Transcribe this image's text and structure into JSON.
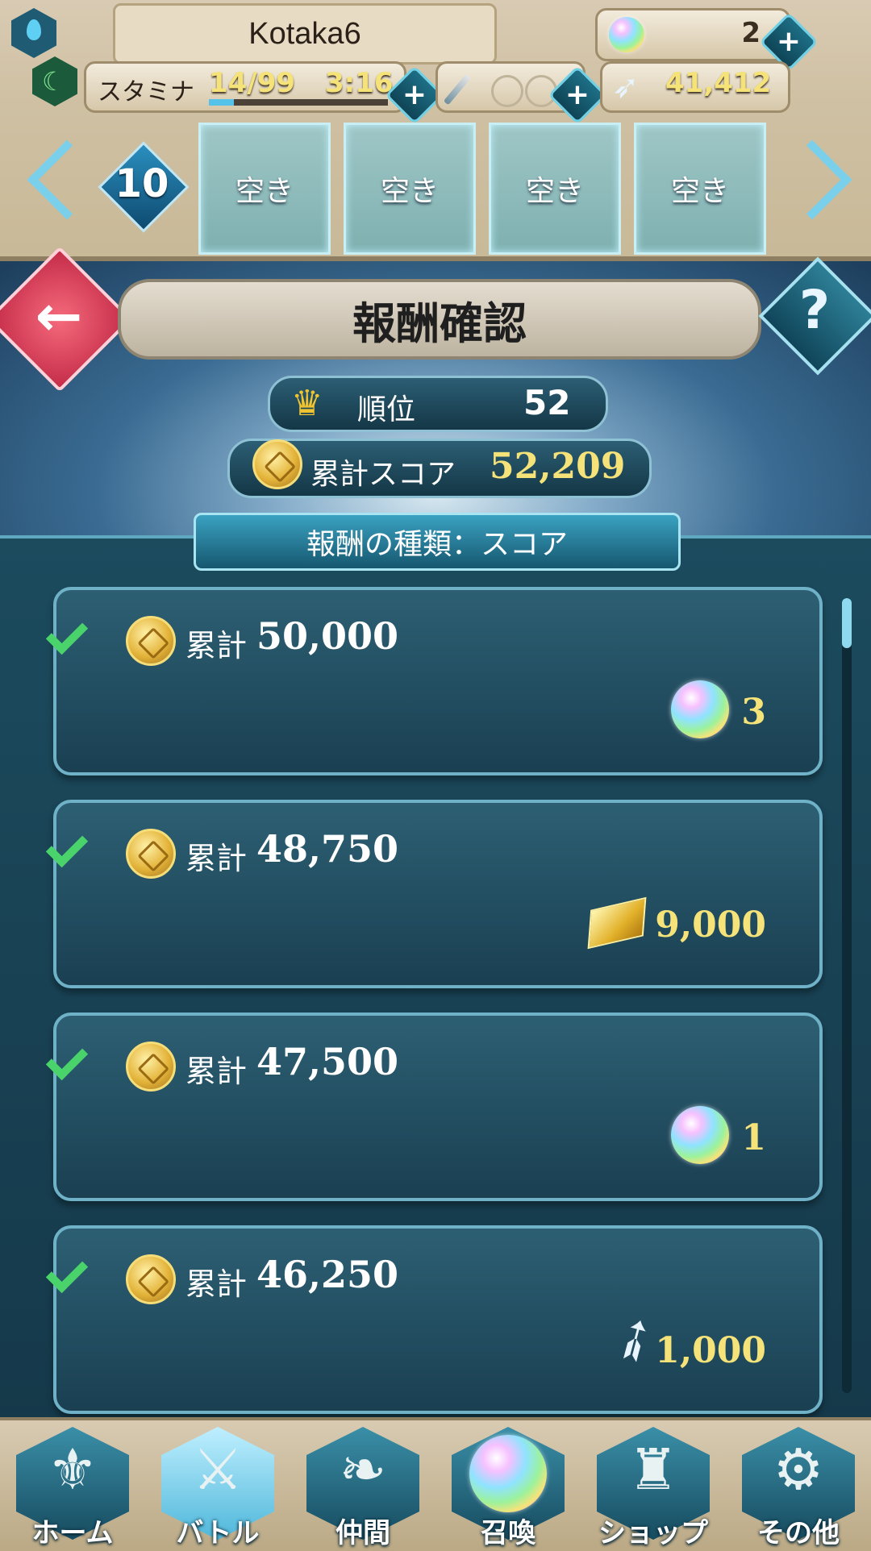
{
  "header": {
    "player_name": "Kotaka6",
    "orbs": "2",
    "stamina_label": "スタミナ",
    "stamina_value": "14/99",
    "stamina_timer": "3:16",
    "stamina_fraction": 0.14,
    "feathers": "41,412"
  },
  "team": {
    "level": "10",
    "slots": [
      "空き",
      "空き",
      "空き",
      "空き"
    ]
  },
  "screen": {
    "title": "報酬確認",
    "rank_label": "順位",
    "rank_value": "52",
    "score_label": "累計スコア",
    "score_value": "52,209",
    "reward_type": "報酬の種類：スコア"
  },
  "rewards": [
    {
      "label": "累計",
      "threshold": "50,000",
      "reward_amount": "3",
      "reward_icon": "orb-icon",
      "claimed": true
    },
    {
      "label": "累計",
      "threshold": "48,750",
      "reward_amount": "9,000",
      "reward_icon": "gold-gem-icon",
      "claimed": true
    },
    {
      "label": "累計",
      "threshold": "47,500",
      "reward_amount": "1",
      "reward_icon": "orb-icon",
      "claimed": true
    },
    {
      "label": "累計",
      "threshold": "46,250",
      "reward_amount": "1,000",
      "reward_icon": "feather-icon",
      "claimed": true
    }
  ],
  "nav": [
    {
      "label": "ホーム",
      "icon": "home-icon"
    },
    {
      "label": "バトル",
      "icon": "battle-icon",
      "active": true
    },
    {
      "label": "仲間",
      "icon": "allies-icon"
    },
    {
      "label": "召喚",
      "icon": "summon-icon"
    },
    {
      "label": "ショップ",
      "icon": "shop-icon"
    },
    {
      "label": "その他",
      "icon": "settings-icon"
    }
  ],
  "colors": {
    "accent": "#5fc3e4",
    "gold_text": "#f5e37a",
    "check": "#4ad36a",
    "back_button": "#e84a64"
  }
}
